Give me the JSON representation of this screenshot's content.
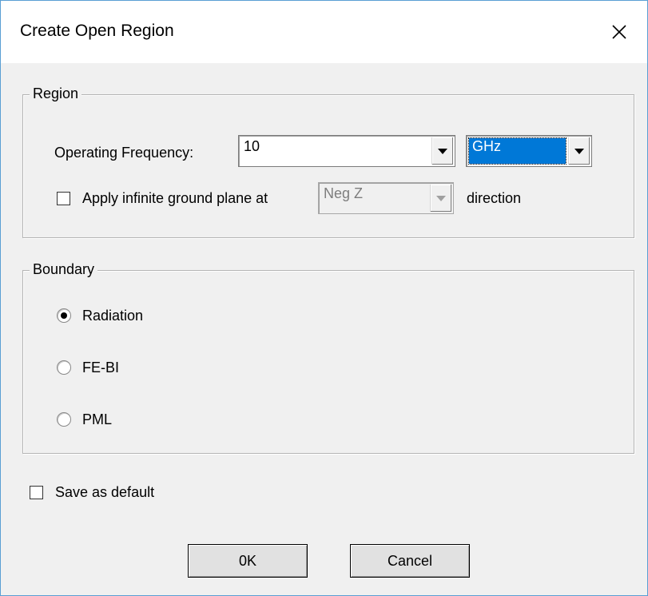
{
  "dialog": {
    "title": "Create Open Region"
  },
  "region": {
    "group_label": "Region",
    "frequency_label": "Operating Frequency:",
    "frequency_value": "10",
    "frequency_unit": "GHz",
    "ground_plane_label": "Apply infinite ground plane at",
    "ground_plane_checked": false,
    "ground_plane_direction": "Neg Z",
    "direction_label": "direction"
  },
  "boundary": {
    "group_label": "Boundary",
    "options": [
      {
        "label": "Radiation",
        "selected": true
      },
      {
        "label": "FE-BI",
        "selected": false
      },
      {
        "label": "PML",
        "selected": false
      }
    ]
  },
  "save_default": {
    "label": "Save as default",
    "checked": false
  },
  "buttons": {
    "ok": "0K",
    "cancel": "Cancel"
  }
}
